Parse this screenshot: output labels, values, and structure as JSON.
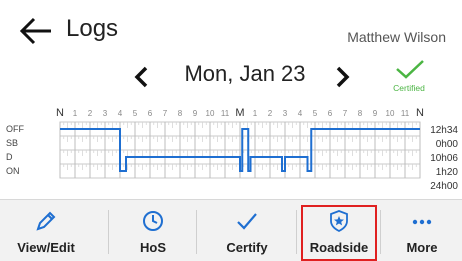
{
  "header": {
    "title": "Logs",
    "user": "Matthew Wilson"
  },
  "date_nav": {
    "date": "Mon, Jan 23",
    "status": "Certified"
  },
  "log_grid": {
    "hour_labels": [
      "N",
      "1",
      "2",
      "3",
      "4",
      "5",
      "6",
      "7",
      "8",
      "9",
      "10",
      "11",
      "M",
      "1",
      "2",
      "3",
      "4",
      "5",
      "6",
      "7",
      "8",
      "9",
      "10",
      "11",
      "N"
    ],
    "status_rows": [
      "OFF",
      "SB",
      "D",
      "ON"
    ],
    "totals": [
      "12h34",
      "0h00",
      "10h06",
      "1h20"
    ],
    "grand_total": "24h00",
    "line_color": "#1f6fd1",
    "events": [
      {
        "start": 0,
        "status": "OFF"
      },
      {
        "start": 4.0,
        "status": "ON"
      },
      {
        "start": 4.4,
        "status": "D"
      },
      {
        "start": 12.0,
        "status": "ON"
      },
      {
        "start": 12.15,
        "status": "OFF"
      },
      {
        "start": 12.55,
        "status": "ON"
      },
      {
        "start": 12.7,
        "status": "D"
      },
      {
        "start": 14.8,
        "status": "ON"
      },
      {
        "start": 15.0,
        "status": "D"
      },
      {
        "start": 16.5,
        "status": "ON"
      },
      {
        "start": 16.75,
        "status": "OFF"
      },
      {
        "start": 24,
        "status": "OFF"
      }
    ]
  },
  "toolbar": {
    "items": [
      {
        "label": "View/Edit",
        "icon": "pencil-icon"
      },
      {
        "label": "HoS",
        "icon": "clock-icon"
      },
      {
        "label": "Certify",
        "icon": "check-icon"
      },
      {
        "label": "Roadside",
        "icon": "badge-icon"
      },
      {
        "label": "More",
        "icon": "more-icon"
      }
    ],
    "highlighted": "Roadside",
    "highlight_color": "#e02020",
    "accent_color": "#1f6fd1"
  }
}
